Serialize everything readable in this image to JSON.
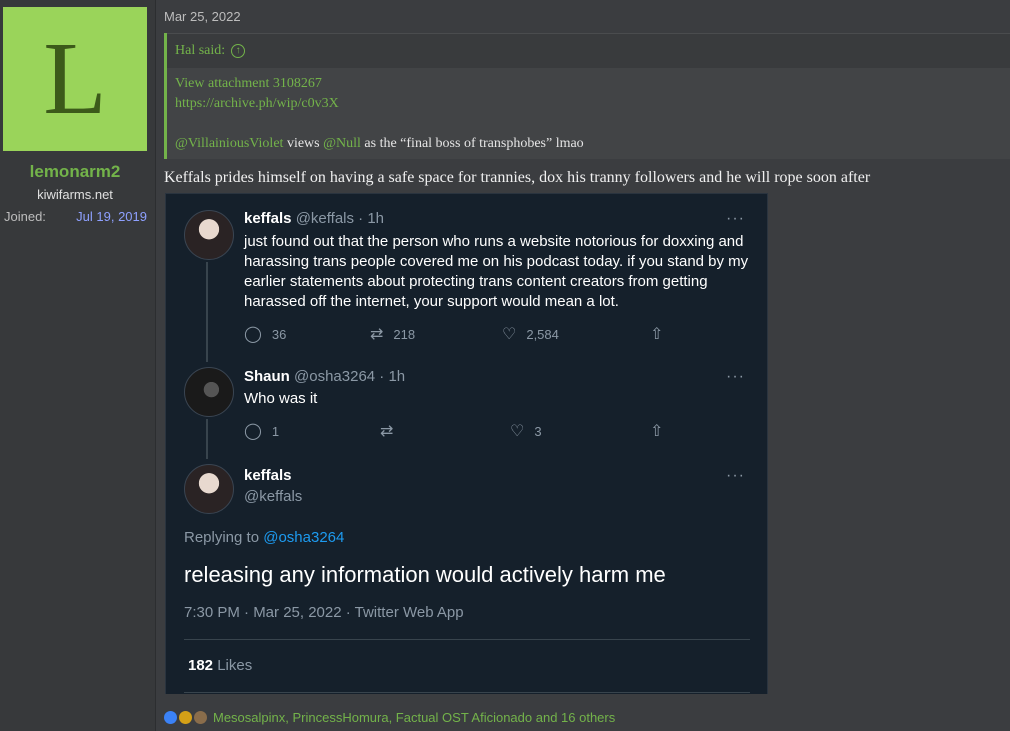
{
  "user": {
    "avatar_letter": "L",
    "name": "lemonarm2",
    "title": "kiwifarms.net",
    "joined_label": "Joined:",
    "joined_date": "Jul 19, 2019"
  },
  "post": {
    "date": "Mar 25, 2022",
    "quote": {
      "author": "Hal said:",
      "attachment": "View attachment 3108267",
      "link": "https://archive.ph/wip/c0v3X",
      "mention1": "@VillainiousViolet",
      "text_mid": " views ",
      "mention2": "@Null",
      "text_end": " as the “final boss of transphobes” lmao"
    },
    "body": "Keffals prides himself on having a safe space for trannies, dox his tranny followers and he will rope soon after"
  },
  "tweet": {
    "t1": {
      "name": "keffals",
      "handle": "@keffals · 1h",
      "text": "just found out that the person who runs a website notorious for doxxing and harassing trans people covered me on his podcast today. if you stand by my earlier statements about protecting trans content creators from getting harassed off the internet, your support would mean a lot.",
      "replies": "36",
      "retweets": "218",
      "likes": "2,584"
    },
    "t2": {
      "name": "Shaun",
      "handle": "@osha3264 · 1h",
      "text": "Who was it",
      "replies": "1",
      "retweets": "",
      "likes": "3"
    },
    "t3": {
      "name": "keffals",
      "handle": "@keffals",
      "replying_label": "Replying to ",
      "replying_to": "@osha3264",
      "text": "releasing any information would actively harm me",
      "meta": "7:30 PM · Mar 25, 2022 · Twitter Web App",
      "likes_count": "182",
      "likes_label": " Likes"
    },
    "more_glyph": "···"
  },
  "reactions": {
    "text": "Mesosalpinx, PrincessHomura, Factual OST Aficionado and 16 others"
  },
  "colors": {
    "accent": "#73b34a",
    "link_blue": "#1d9bf0",
    "avatar_bg": "#9ad45a"
  },
  "icons": [
    "reply-icon",
    "retweet-icon",
    "like-icon",
    "share-icon",
    "more-icon"
  ]
}
